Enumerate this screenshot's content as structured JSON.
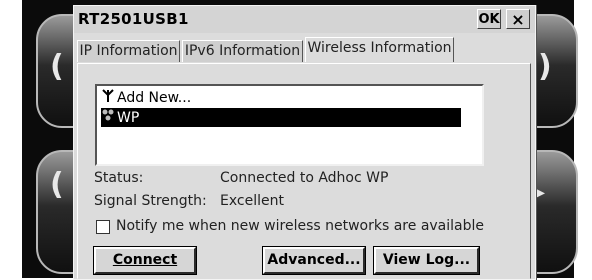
{
  "window": {
    "title": "RT2501USB1",
    "ok_label": "OK",
    "close_label": "×"
  },
  "tabs": [
    {
      "label": "IP Information",
      "active": false
    },
    {
      "label": "IPv6 Information",
      "active": false
    },
    {
      "label": "Wireless Information",
      "active": true
    }
  ],
  "networks": [
    {
      "label": "Add New...",
      "icon": "antenna-icon",
      "selected": false
    },
    {
      "label": "WP",
      "icon": "adhoc-network-icon",
      "selected": true
    }
  ],
  "status": {
    "status_label": "Status:",
    "status_value": "Connected to Adhoc WP",
    "signal_label": "Signal Strength:",
    "signal_value": "Excellent"
  },
  "notify": {
    "label": "Notify me when new wireless networks are available",
    "checked": false
  },
  "buttons": {
    "connect": "Connect",
    "advanced": "Advanced...",
    "view_log": "View Log..."
  }
}
